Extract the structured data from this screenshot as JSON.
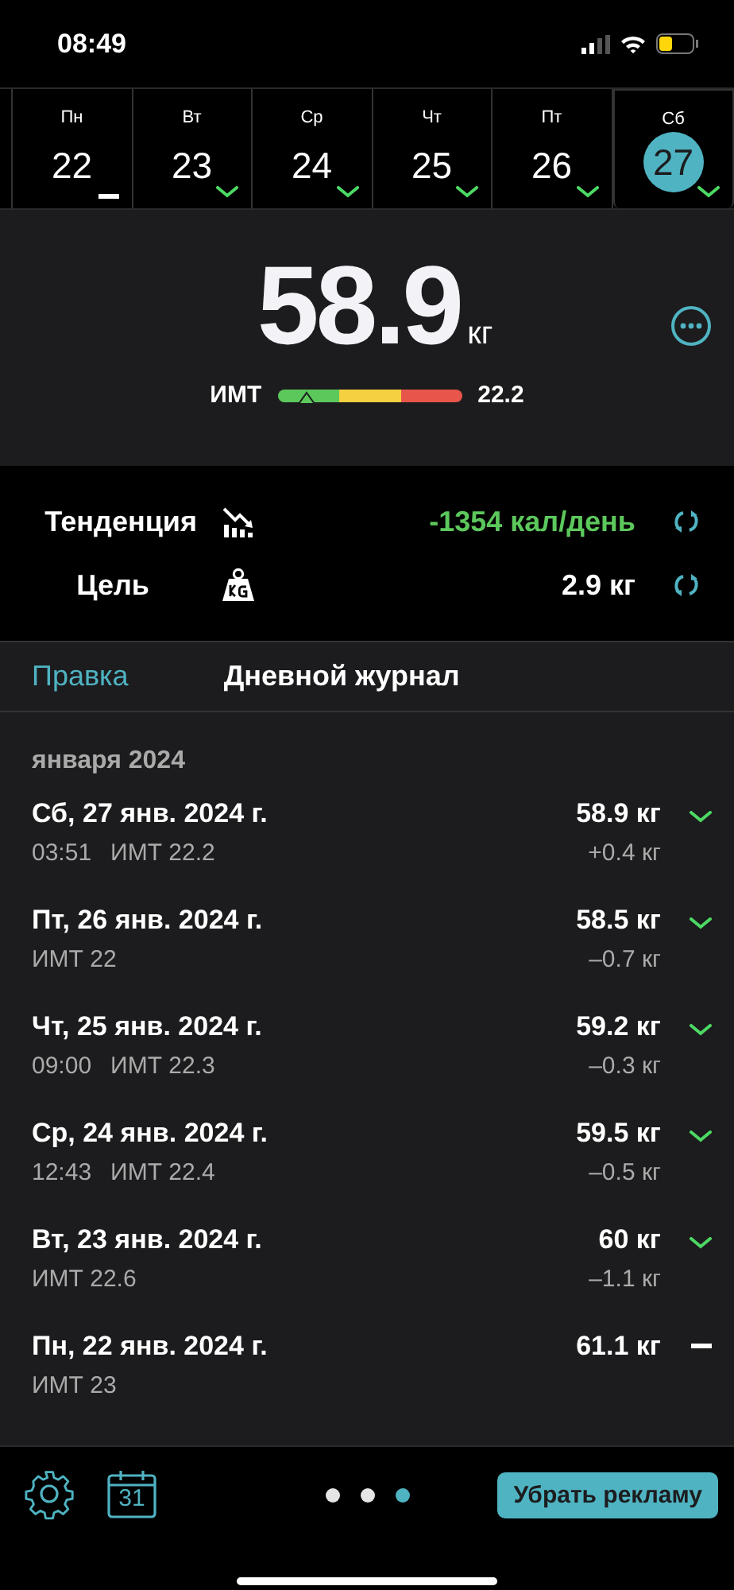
{
  "status_bar": {
    "time": "08:49"
  },
  "days": [
    {
      "weekday": "Пн",
      "day": "22",
      "kind": "flat",
      "selected": false
    },
    {
      "weekday": "Вт",
      "day": "23",
      "kind": "down",
      "selected": false
    },
    {
      "weekday": "Ср",
      "day": "24",
      "kind": "down",
      "selected": false
    },
    {
      "weekday": "Чт",
      "day": "25",
      "kind": "down",
      "selected": false
    },
    {
      "weekday": "Пт",
      "day": "26",
      "kind": "down",
      "selected": false
    },
    {
      "weekday": "Сб",
      "day": "27",
      "kind": "down",
      "selected": true
    }
  ],
  "weight": {
    "value": "58.9",
    "unit": "кг",
    "bmi_label": "ИМТ",
    "bmi_value": "22.2",
    "level": 0.12
  },
  "stats": [
    {
      "label": "Тенденция",
      "kind": "trend",
      "value": "-1354 кал/день",
      "positive": true
    },
    {
      "label": "Цель",
      "kind": "goal",
      "value": "2.9 кг",
      "positive": false
    }
  ],
  "journal_header": {
    "edit": "Правка",
    "title": "Дневной журнал"
  },
  "month": "января 2024",
  "entries": [
    {
      "date": "Сб, 27 янв. 2024 г.",
      "time": "03:51",
      "bmi": "ИМТ 22.2",
      "weight": "58.9 кг",
      "change": "+0.4 кг",
      "kind": "down"
    },
    {
      "date": "Пт, 26 янв. 2024 г.",
      "bmi": "ИМТ 22",
      "weight": "58.5 кг",
      "change": "–0.7 кг",
      "kind": "down"
    },
    {
      "date": "Чт, 25 янв. 2024 г.",
      "time": "09:00",
      "bmi": "ИМТ 22.3",
      "weight": "59.2 кг",
      "change": "–0.3 кг",
      "kind": "down"
    },
    {
      "date": "Ср, 24 янв. 2024 г.",
      "time": "12:43",
      "bmi": "ИМТ 22.4",
      "weight": "59.5 кг",
      "change": "–0.5 кг",
      "kind": "down"
    },
    {
      "date": "Вт, 23 янв. 2024 г.",
      "bmi": "ИМТ 22.6",
      "weight": "60 кг",
      "change": "–1.1 кг",
      "kind": "down"
    },
    {
      "date": "Пн, 22 янв. 2024 г.",
      "bmi": "ИМТ 23",
      "weight": "61.1 кг",
      "kind": "flat"
    }
  ],
  "footer": {
    "calendar_day": "31",
    "pages": [
      {
        "selected": false
      },
      {
        "selected": false
      },
      {
        "selected": true
      }
    ],
    "remove_ads": "Убрать рекламу"
  }
}
